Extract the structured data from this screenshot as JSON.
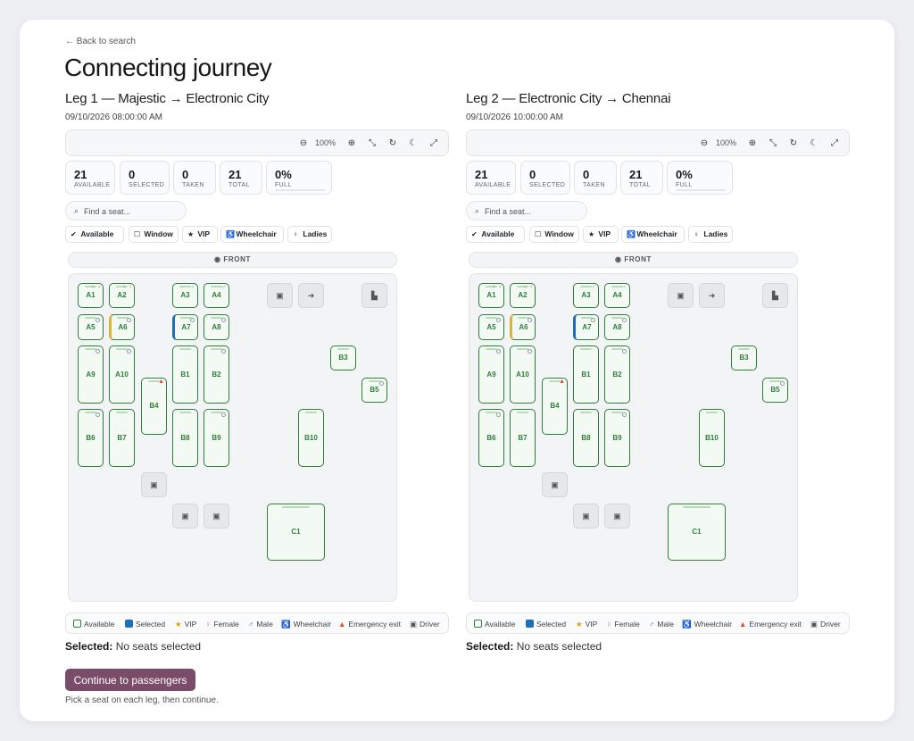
{
  "page": {
    "back_link": "← Back to search",
    "title": "Connecting journey",
    "continue_label": "Continue to passengers",
    "hint": "Pick a seat on each leg, then continue."
  },
  "colors": {
    "accent": "#7a4c6a",
    "seat_available": "#2f7d3a",
    "seat_selected": "#1f6fb8",
    "vip_star": "#d8a21c",
    "emergency": "#d9531e"
  },
  "legs": [
    {
      "title": "Leg 1 — Majestic → Electronic City",
      "datetime": "09/10/2026 08:00:00 AM",
      "zoom": "100%",
      "stats": {
        "available": "21",
        "available_label": "AVAILABLE",
        "selected": "0",
        "selected_label": "SELECTED",
        "taken": "0",
        "taken_label": "TAKEN",
        "total": "21",
        "total_label": "TOTAL",
        "full": "0%",
        "full_label": "FULL",
        "full_fraction": 0
      },
      "search_placeholder": "Find a seat...",
      "filters": [
        "Available",
        "Window",
        "VIP",
        "Wheelchair",
        "Ladies"
      ],
      "front_label": "FRONT",
      "seats": [
        "A1",
        "A2",
        "A3",
        "A4",
        "A5",
        "A6",
        "A7",
        "A8",
        "A9",
        "A10",
        "B1",
        "B2",
        "B3",
        "B4",
        "B5",
        "B6",
        "B7",
        "B8",
        "B9",
        "B10",
        "C1"
      ],
      "legend": [
        "Available",
        "Selected",
        "VIP",
        "Female",
        "Male",
        "Wheelchair",
        "Emergency exit",
        "Driver"
      ],
      "selected_prefix": "Selected:",
      "selected_value": "No seats selected"
    },
    {
      "title": "Leg 2 — Electronic City → Chennai",
      "datetime": "09/10/2026 10:00:00 AM",
      "zoom": "100%",
      "stats": {
        "available": "21",
        "available_label": "AVAILABLE",
        "selected": "0",
        "selected_label": "SELECTED",
        "taken": "0",
        "taken_label": "TAKEN",
        "total": "21",
        "total_label": "TOTAL",
        "full": "0%",
        "full_label": "FULL",
        "full_fraction": 0
      },
      "search_placeholder": "Find a seat...",
      "filters": [
        "Available",
        "Window",
        "VIP",
        "Wheelchair",
        "Ladies"
      ],
      "front_label": "FRONT",
      "seats": [
        "A1",
        "A2",
        "A3",
        "A4",
        "A5",
        "A6",
        "A7",
        "A8",
        "A9",
        "A10",
        "B1",
        "B2",
        "B3",
        "B4",
        "B5",
        "B6",
        "B7",
        "B8",
        "B9",
        "B10",
        "C1"
      ],
      "legend": [
        "Available",
        "Selected",
        "VIP",
        "Female",
        "Male",
        "Wheelchair",
        "Emergency exit",
        "Driver"
      ],
      "selected_prefix": "Selected:",
      "selected_value": "No seats selected"
    }
  ]
}
